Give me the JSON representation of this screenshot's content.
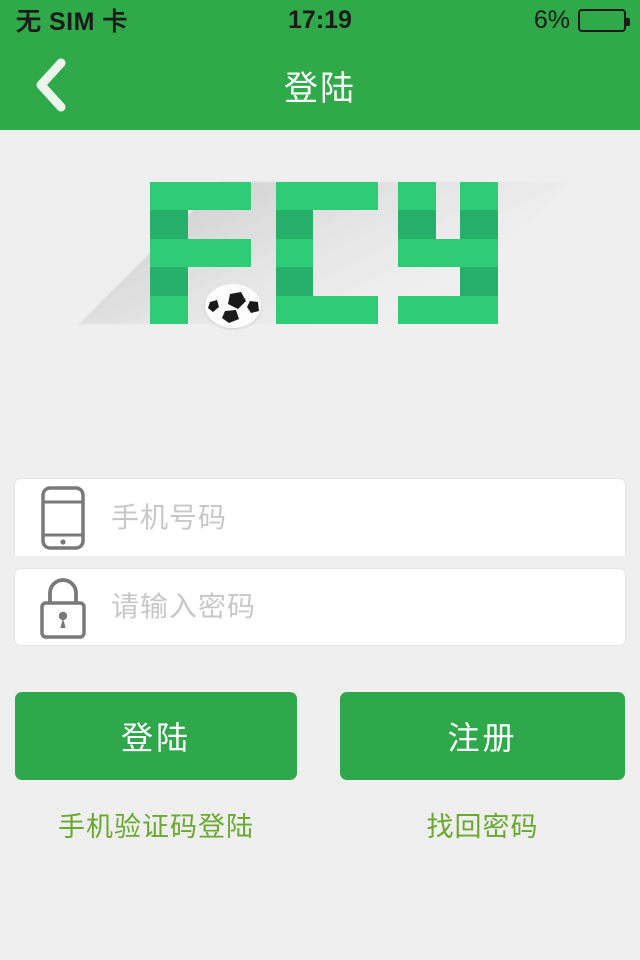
{
  "status_bar": {
    "carrier": "无 SIM 卡",
    "time": "17:19",
    "battery_percent": "6%",
    "battery_level": 6,
    "battery_color": "#ef4e23"
  },
  "nav": {
    "title": "登陆",
    "back_icon": "chevron-left-icon",
    "background": "#30a94a"
  },
  "logo": {
    "text": "FCY",
    "ball_icon": "soccer-ball-icon",
    "light_green": "#2ecc77",
    "dark_green": "#26b069"
  },
  "form": {
    "phone": {
      "icon": "smartphone-icon",
      "placeholder": "手机号码",
      "value": ""
    },
    "password": {
      "icon": "lock-icon",
      "placeholder": "请输入密码",
      "value": ""
    }
  },
  "actions": {
    "login_label": "登陆",
    "register_label": "注册",
    "sms_login_label": "手机验证码登陆",
    "forgot_password_label": "找回密码",
    "button_color": "#2fa84b",
    "link_color": "#6aa82f"
  }
}
